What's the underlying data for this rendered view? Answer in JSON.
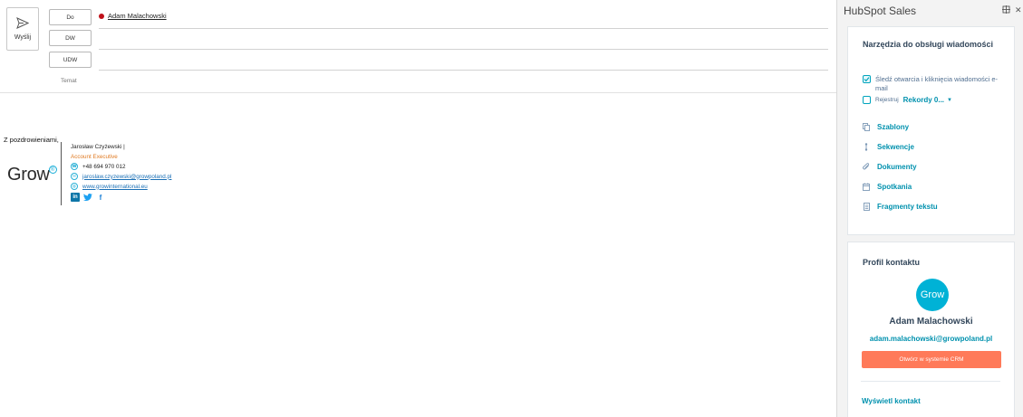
{
  "compose": {
    "send_label": "Wyślij",
    "to_label": "Do",
    "cc_label": "DW",
    "bcc_label": "UDW",
    "subject_label": "Temat",
    "recipient_name": "Adam Malachowski"
  },
  "body": {
    "greeting": "Z pozdrowieniami,",
    "signature": {
      "logo_text": "Grow",
      "logo_mark": "®",
      "name": "Jarosław Czyżewski |",
      "role": "Account Executive",
      "phone": "+48 694 970 012",
      "email": "jaroslaw.czyzewski@growpoland.pl",
      "website": "www.growinternational.eu",
      "social": [
        "in",
        "t",
        "f"
      ]
    }
  },
  "hubspot": {
    "title": "HubSpot Sales",
    "tools_card": {
      "heading": "Narzędzia do obsługi wiadomości",
      "track_label": "Śledź otwarcia i kliknięcia wiadomości e-mail",
      "track_checked": true,
      "log_label": "Rejestruj",
      "log_value": "Rekordy 0...",
      "log_checked": false,
      "tools": [
        {
          "label": "Szablony",
          "icon": "templates-icon"
        },
        {
          "label": "Sekwencje",
          "icon": "sequences-icon"
        },
        {
          "label": "Dokumenty",
          "icon": "documents-icon"
        },
        {
          "label": "Spotkania",
          "icon": "meetings-icon"
        },
        {
          "label": "Fragmenty tekstu",
          "icon": "snippets-icon"
        }
      ]
    },
    "profile_card": {
      "heading": "Profil kontaktu",
      "avatar_text": "Grow",
      "name": "Adam Malachowski",
      "email": "adam.malachowski@growpoland.pl",
      "crm_button": "Otwórz w systemie CRM",
      "view_contact": "Wyświetl kontakt"
    }
  },
  "colors": {
    "accent": "#0091ae",
    "cta": "#ff7a59",
    "heading": "#33475b",
    "signature_role": "#e07a22",
    "avatar_bg": "#00b2d6",
    "presence_dot": "#c0111a"
  }
}
